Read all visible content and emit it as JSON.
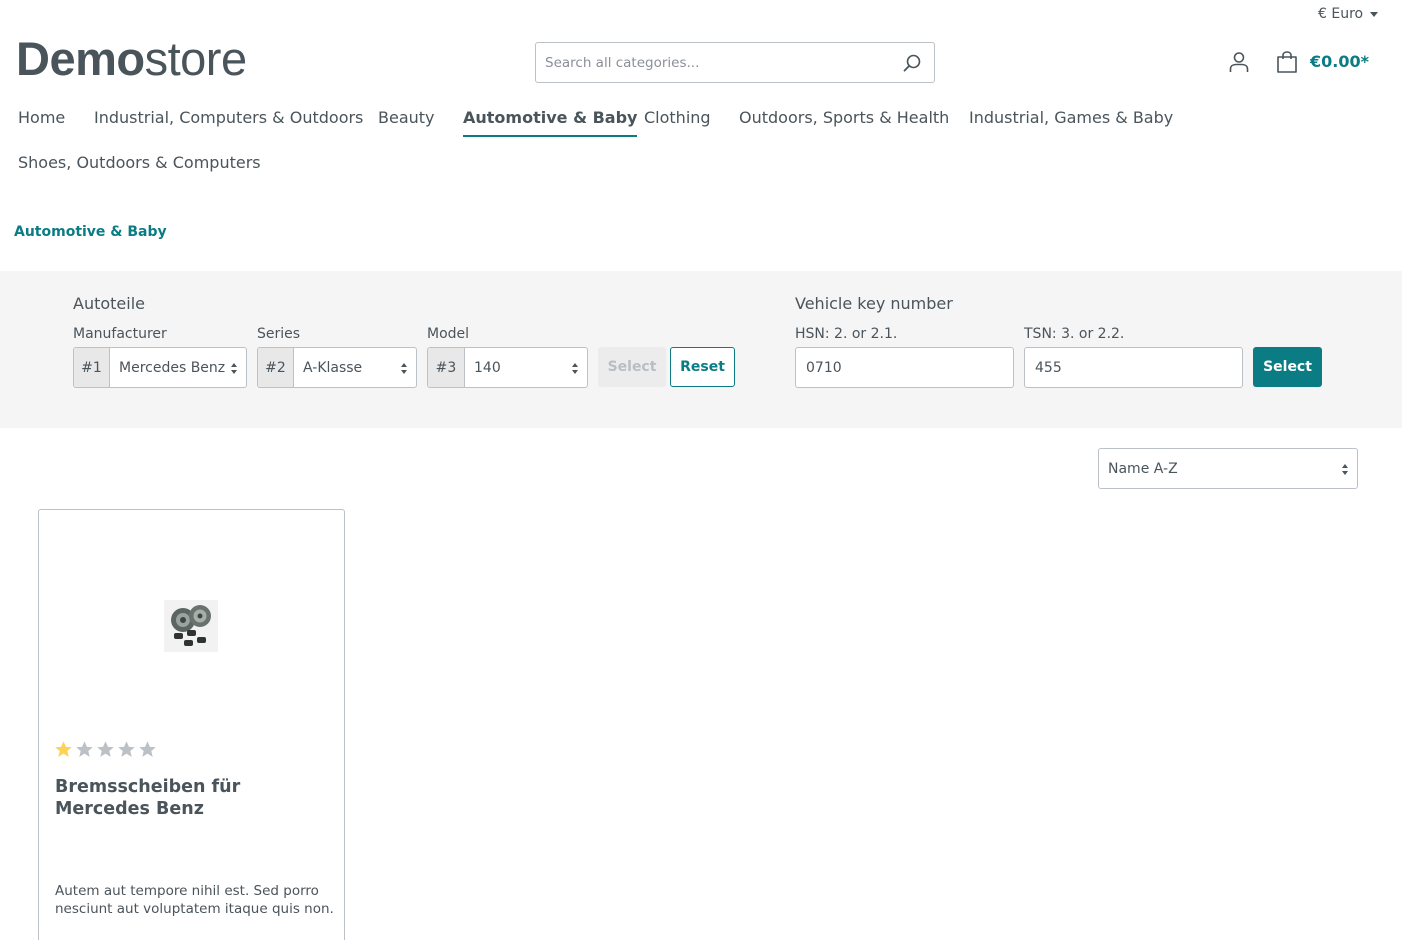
{
  "header": {
    "currency": "€ Euro",
    "logo_bold": "Demo",
    "logo_light": "store",
    "search_placeholder": "Search all categories...",
    "cart_total": "€0.00*"
  },
  "nav": {
    "items": [
      "Home",
      "Industrial, Computers & Outdoors",
      "Beauty",
      "Automotive & Baby",
      "Clothing",
      "Outdoors, Sports & Health",
      "Industrial, Games & Baby",
      "Shoes, Outdoors & Computers"
    ],
    "active": "Automotive & Baby"
  },
  "breadcrumb": "Automotive & Baby",
  "filter": {
    "autoteile": {
      "title": "Autoteile",
      "manufacturer_label": "Manufacturer",
      "manufacturer_num": "#1",
      "manufacturer_value": "Mercedes Benz",
      "series_label": "Series",
      "series_num": "#2",
      "series_value": "A-Klasse",
      "model_label": "Model",
      "model_num": "#3",
      "model_value": "140",
      "select_label": "Select",
      "reset_label": "Reset"
    },
    "vehicle_key": {
      "title": "Vehicle key number",
      "hsn_label": "HSN: 2. or 2.1.",
      "hsn_value": "0710",
      "tsn_label": "TSN: 3. or 2.2.",
      "tsn_value": "455",
      "select_label": "Select"
    }
  },
  "sort": {
    "selected": "Name A-Z"
  },
  "products": [
    {
      "name": "Bremsscheiben für Mercedes Benz",
      "rating": 1,
      "rating_max": 5,
      "description": "Autem aut tempore nihil est. Sed porro nesciunt aut voluptatem itaque quis non."
    }
  ],
  "colors": {
    "accent": "#0b7c84",
    "text": "#4a545b",
    "star_filled": "#ffd154",
    "star_empty": "#bcc1c7",
    "panel_bg": "#f5f5f5"
  },
  "icons": [
    "chevron-down-icon",
    "search-icon",
    "user-icon",
    "shopping-bag-icon",
    "star-icon",
    "product-image"
  ]
}
